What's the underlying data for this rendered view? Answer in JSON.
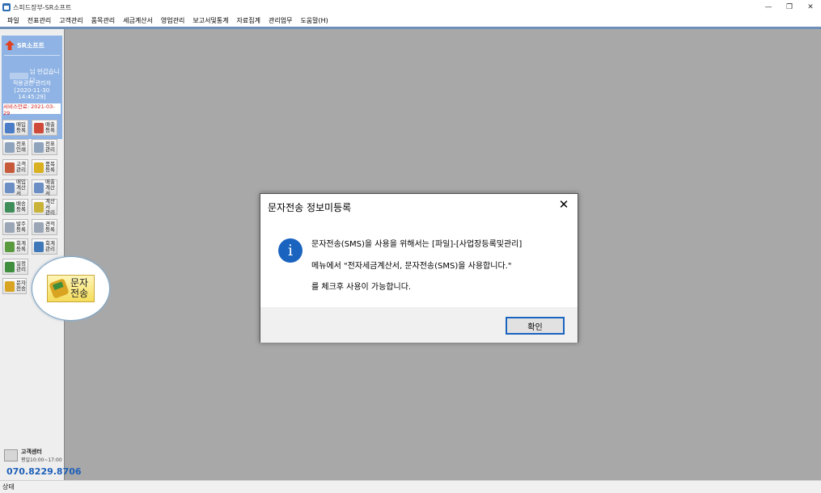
{
  "window": {
    "title": "스피드장부-SR소프트",
    "controls": [
      "—",
      "❐",
      "✕"
    ]
  },
  "menu": [
    "파일",
    "전표관리",
    "고객관리",
    "품목관리",
    "세금계산서",
    "영업관리",
    "보고서및통계",
    "자료집계",
    "관리업무",
    "도움말(H)"
  ],
  "sidebar": {
    "brand": "SR소프트",
    "greeting": "님 반갑습니다.",
    "role": "적용권한 관리자",
    "login_time": "[2020-11-30 14:45:29]",
    "service_date": "서비스만료: 2021-03-29",
    "buttons": [
      {
        "l1": "매입",
        "l2": "등록",
        "color": "#4a7cc7"
      },
      {
        "l1": "매출",
        "l2": "등록",
        "color": "#d04a3a"
      },
      {
        "l1": "전표",
        "l2": "인쇄",
        "color": "#8fa3bd"
      },
      {
        "l1": "전표",
        "l2": "관리",
        "color": "#8fa3bd"
      },
      {
        "l1": "고객",
        "l2": "관리",
        "color": "#c85a3c"
      },
      {
        "l1": "품목",
        "l2": "등록",
        "color": "#d9b020"
      },
      {
        "l1": "매입",
        "l2": "계산서",
        "color": "#6b8fc4"
      },
      {
        "l1": "매출",
        "l2": "계산서",
        "color": "#6b8fc4"
      },
      {
        "l1": "배송",
        "l2": "등록",
        "color": "#3f8e5a"
      },
      {
        "l1": "계산서",
        "l2": "관리",
        "color": "#c9b238"
      },
      {
        "l1": "발주",
        "l2": "등록",
        "color": "#9aa6b6"
      },
      {
        "l1": "견적",
        "l2": "등록",
        "color": "#9aa6b6"
      },
      {
        "l1": "회계",
        "l2": "등록",
        "color": "#5a9a3e"
      },
      {
        "l1": "회계",
        "l2": "관리",
        "color": "#3e78b8"
      },
      {
        "l1": "일정",
        "l2": "관리",
        "color": "#3e8e3e"
      },
      {
        "l1": "",
        "l2": "",
        "color": "#d9a422"
      },
      {
        "l1": "문자",
        "l2": "전송",
        "color": "#d9a422"
      }
    ],
    "highlight": {
      "l1": "문자",
      "l2": "전송"
    },
    "support": {
      "title": "고객센터",
      "hours": "평일10:00~17:00",
      "phone": "070.8229.8706"
    }
  },
  "status": "상태",
  "dialog": {
    "title": "문자전송 정보미등록",
    "close": "✕",
    "icon": "i",
    "lines": [
      "문자전송(SMS)을 사용을 위해서는 [파일]-[사업장등록및관리]",
      "메뉴에서 \"전자세금계산서, 문자전송(SMS)을 사용합니다.\"",
      "를 체크후 사용이 가능합니다."
    ],
    "ok": "확인"
  }
}
